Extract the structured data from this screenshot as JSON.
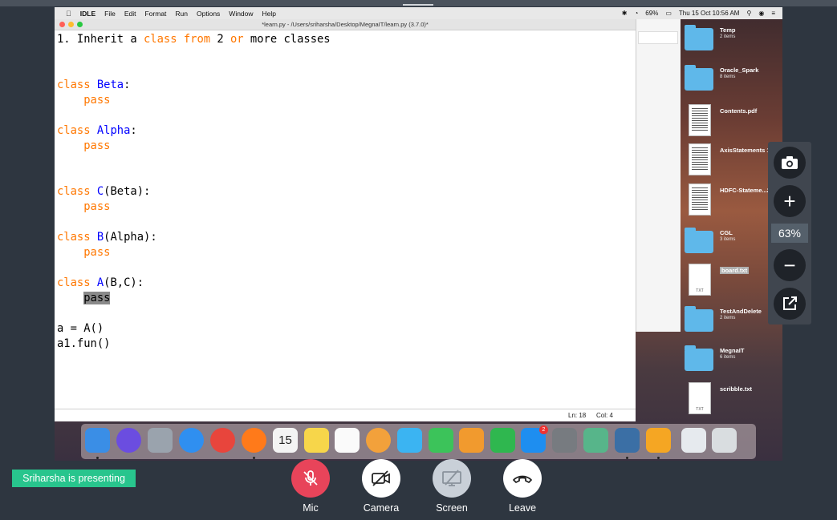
{
  "menubar": {
    "app": "IDLE",
    "items": [
      "File",
      "Edit",
      "Format",
      "Run",
      "Options",
      "Window",
      "Help"
    ],
    "battery": "69%",
    "datetime": "Thu 15 Oct  10:56 AM"
  },
  "editor": {
    "title": "*learn.py - /Users/sriharsha/Desktop/MegnaIT/learn.py (3.7.0)*",
    "status_ln": "Ln: 18",
    "status_col": "Col: 4",
    "lines": [
      {
        "segments": [
          {
            "t": "1. Inherit a ",
            "c": "plain"
          },
          {
            "t": "class",
            "c": "kw"
          },
          {
            "t": " ",
            "c": "plain"
          },
          {
            "t": "from",
            "c": "kw"
          },
          {
            "t": " 2 ",
            "c": "plain"
          },
          {
            "t": "or",
            "c": "kw"
          },
          {
            "t": " more classes",
            "c": "plain"
          }
        ]
      },
      {
        "segments": []
      },
      {
        "segments": []
      },
      {
        "segments": [
          {
            "t": "class",
            "c": "kw"
          },
          {
            "t": " ",
            "c": "plain"
          },
          {
            "t": "Beta",
            "c": "def"
          },
          {
            "t": ":",
            "c": "plain"
          }
        ]
      },
      {
        "segments": [
          {
            "t": "    ",
            "c": "plain"
          },
          {
            "t": "pass",
            "c": "kw"
          }
        ]
      },
      {
        "segments": []
      },
      {
        "segments": [
          {
            "t": "class",
            "c": "kw"
          },
          {
            "t": " ",
            "c": "plain"
          },
          {
            "t": "Alpha",
            "c": "def"
          },
          {
            "t": ":",
            "c": "plain"
          }
        ]
      },
      {
        "segments": [
          {
            "t": "    ",
            "c": "plain"
          },
          {
            "t": "pass",
            "c": "kw"
          }
        ]
      },
      {
        "segments": []
      },
      {
        "segments": []
      },
      {
        "segments": [
          {
            "t": "class",
            "c": "kw"
          },
          {
            "t": " ",
            "c": "plain"
          },
          {
            "t": "C",
            "c": "def"
          },
          {
            "t": "(Beta):",
            "c": "plain"
          }
        ]
      },
      {
        "segments": [
          {
            "t": "    ",
            "c": "plain"
          },
          {
            "t": "pass",
            "c": "kw"
          }
        ]
      },
      {
        "segments": []
      },
      {
        "segments": [
          {
            "t": "class",
            "c": "kw"
          },
          {
            "t": " ",
            "c": "plain"
          },
          {
            "t": "B",
            "c": "def"
          },
          {
            "t": "(Alpha):",
            "c": "plain"
          }
        ]
      },
      {
        "segments": [
          {
            "t": "    ",
            "c": "plain"
          },
          {
            "t": "pass",
            "c": "kw"
          }
        ]
      },
      {
        "segments": []
      },
      {
        "segments": [
          {
            "t": "class",
            "c": "kw"
          },
          {
            "t": " ",
            "c": "plain"
          },
          {
            "t": "A",
            "c": "def"
          },
          {
            "t": "(B,C):",
            "c": "plain"
          }
        ]
      },
      {
        "segments": [
          {
            "t": "    ",
            "c": "plain"
          },
          {
            "t": "pass",
            "c": "sel"
          }
        ]
      },
      {
        "segments": []
      },
      {
        "segments": [
          {
            "t": "a = A()",
            "c": "plain"
          }
        ]
      },
      {
        "segments": [
          {
            "t": "a1.fun()",
            "c": "plain"
          }
        ]
      }
    ]
  },
  "desktop_icons": [
    {
      "name": "Temp",
      "sub": "2 items",
      "kind": "folder"
    },
    {
      "name": "Oracle_Spark",
      "sub": "8 items",
      "kind": "folder"
    },
    {
      "name": "Contents.pdf",
      "sub": "",
      "kind": "doc"
    },
    {
      "name": "AxisStatements 19-20",
      "sub": "",
      "kind": "doc"
    },
    {
      "name": "HDFC-Stateme...2019-",
      "sub": "",
      "kind": "doc"
    },
    {
      "name": "CGL",
      "sub": "3 items",
      "kind": "folder"
    },
    {
      "name": "board.txt",
      "sub": "",
      "kind": "txt",
      "selected": true
    },
    {
      "name": "TestAndDelete",
      "sub": "2 items",
      "kind": "folder"
    },
    {
      "name": "MegnaIT",
      "sub": "6 items",
      "kind": "folder"
    },
    {
      "name": "scribble.txt",
      "sub": "",
      "kind": "txt"
    }
  ],
  "dock_apps": [
    {
      "name": "finder",
      "color": "#3a8ee6"
    },
    {
      "name": "siri",
      "color": "#6b4de0"
    },
    {
      "name": "launchpad",
      "color": "#9aa3ad"
    },
    {
      "name": "safari",
      "color": "#2f8ff0"
    },
    {
      "name": "chrome",
      "color": "#e8453c"
    },
    {
      "name": "firefox",
      "color": "#ff7a1a"
    },
    {
      "name": "calendar",
      "color": "#f4f4f4"
    },
    {
      "name": "notes",
      "color": "#f7d64a"
    },
    {
      "name": "reminders",
      "color": "#fafafa"
    },
    {
      "name": "photos",
      "color": "#f2a13b"
    },
    {
      "name": "messages",
      "color": "#3bb4f2"
    },
    {
      "name": "facetime",
      "color": "#3cc35a"
    },
    {
      "name": "pages",
      "color": "#f19a2e"
    },
    {
      "name": "numbers",
      "color": "#2fb74f"
    },
    {
      "name": "app-store",
      "color": "#1e8ef0",
      "badge": "2"
    },
    {
      "name": "system-preferences",
      "color": "#777b80"
    },
    {
      "name": "atom",
      "color": "#57b58a"
    },
    {
      "name": "python",
      "color": "#3b6fa5"
    },
    {
      "name": "flower-app",
      "color": "#f5a623"
    },
    {
      "name": "preview",
      "color": "#e6eaee"
    },
    {
      "name": "trash",
      "color": "#d9dde0"
    }
  ],
  "zoom": {
    "value": "63%"
  },
  "presenting": {
    "text": "Sriharsha is presenting"
  },
  "controls": {
    "mic": "Mic",
    "camera": "Camera",
    "screen": "Screen",
    "leave": "Leave"
  },
  "colors": {
    "mic": "#e8445a",
    "leave": "#ffffff",
    "presenting": "#28c58d"
  }
}
